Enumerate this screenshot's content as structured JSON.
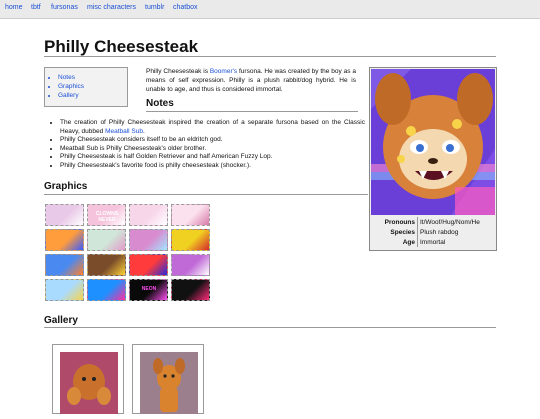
{
  "nav": [
    "home",
    "tbtf",
    "fursonas",
    "misc characters",
    "tumblr",
    "chatbox"
  ],
  "page": {
    "title": "Philly Cheesesteak"
  },
  "toc": [
    "Notes",
    "Graphics",
    "Gallery"
  ],
  "intro": {
    "before": "Philly Cheesesteak is ",
    "link": "Boomer's",
    "after": " fursona. He was created by the boy as a means of self expression. Philly is a plush rabbit/dog hybrid. He is unable to age, and thus is considered immortal."
  },
  "headings": {
    "notes": "Notes",
    "graphics": "Graphics",
    "gallery": "Gallery"
  },
  "notes": {
    "first_before": "The creation of Philly Cheesesteak inspired the creation of a separate fursona based on the Classic Heavy, dubbed ",
    "first_link": "Meatball Sub",
    "first_after": ".",
    "rest": [
      "Philly Cheesesteak considers itself to be an eldritch god.",
      "Meatball Sub is Philly Cheesesteak's older brother.",
      "Philly Cheesesteak is half Golden Retriever and half American Fuzzy Lop.",
      "Philly Cheesesteak's favorite food is philly cheesesteak (shocker.)."
    ]
  },
  "infobox": {
    "rows": [
      {
        "key": "Pronouns",
        "value": "It/Woof/Hug/Nom/He"
      },
      {
        "key": "Species",
        "value": "Plush rabdog"
      },
      {
        "key": "Age",
        "value": "Immortal"
      }
    ]
  },
  "stamps": [
    {
      "bg": "#e9c9e8",
      "fg": "#ffffff",
      "text": ""
    },
    {
      "bg": "#f6c3dc",
      "fg": "#ffffff",
      "text": "CLOWNS NEVER"
    },
    {
      "bg": "#f8d6ea",
      "fg": "#ffffff",
      "text": ""
    },
    {
      "bg": "#fbe0ee",
      "fg": "#d77aa8",
      "text": ""
    },
    {
      "bg": "#ff9c3c",
      "fg": "#3b5bff",
      "text": ""
    },
    {
      "bg": "#cfe6d8",
      "fg": "#e39bc9",
      "text": ""
    },
    {
      "bg": "#d98bd0",
      "fg": "#a0e6ff",
      "text": ""
    },
    {
      "bg": "#f0d020",
      "fg": "#d42a2a",
      "text": ""
    },
    {
      "bg": "#4a8af0",
      "fg": "#ff7f2a",
      "text": ""
    },
    {
      "bg": "#7a4c2a",
      "fg": "#ffd23a",
      "text": ""
    },
    {
      "bg": "#ff3b3b",
      "fg": "#2b2bd6",
      "text": ""
    },
    {
      "bg": "#c06ad8",
      "fg": "#ffffff",
      "text": ""
    },
    {
      "bg": "#a9dbff",
      "fg": "#f7d34a",
      "text": ""
    },
    {
      "bg": "#1e90ff",
      "fg": "#ff2ea0",
      "text": ""
    },
    {
      "bg": "#0a0a0a",
      "fg": "#ff4ef0",
      "text": "NEON"
    },
    {
      "bg": "#111111",
      "fg": "#ff2b7a",
      "text": ""
    }
  ],
  "colors": {
    "link": "#1a4fd6",
    "portrait_bg": "#6a3fd8",
    "gallery_bg": "#b04a6b"
  }
}
